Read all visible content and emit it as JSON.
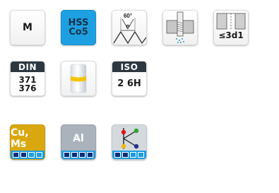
{
  "row1": {
    "material_group": "M",
    "tool_material": {
      "line1": "HSS",
      "line2": "Co5"
    },
    "thread_profile": {
      "angle": "60°",
      "pitch": "P"
    },
    "thread_depth": "≤3d1"
  },
  "row2": {
    "din": {
      "header": "DIN",
      "line1": "371",
      "line2": "376"
    },
    "iso": {
      "header": "ISO",
      "value": "2 6H"
    }
  },
  "row3": {
    "cu_ms": {
      "label": "Cu, Ms",
      "color": "#d9a80e",
      "rating": 2
    },
    "al": {
      "label": "Al",
      "color": "#aab2bb",
      "rating": 4
    },
    "coolant": {
      "rating": 2,
      "dot_colors": [
        "#2da62d",
        "#e1121a",
        "#f2b50a",
        "#2b2f8e"
      ]
    }
  },
  "colors": {
    "accent_blue": "#1b9ce0",
    "dark_header": "#2c3740",
    "ring_yellow": "#f5c400"
  }
}
